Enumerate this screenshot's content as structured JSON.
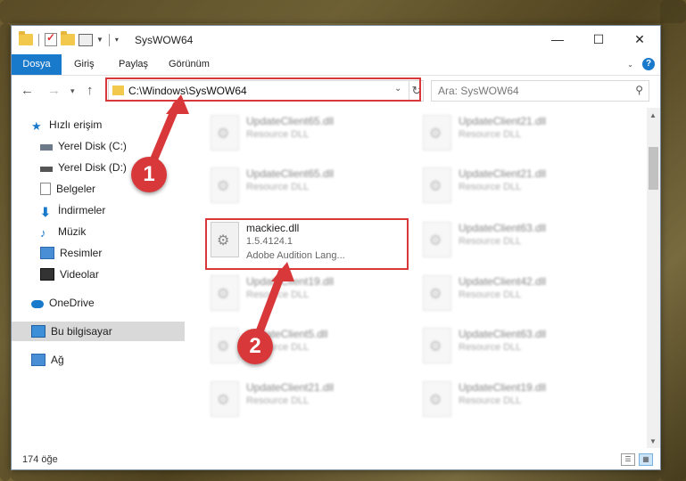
{
  "window": {
    "title": "SysWOW64"
  },
  "ribbon": {
    "tabs": [
      "Dosya",
      "Giriş",
      "Paylaş",
      "Görünüm"
    ]
  },
  "navbar": {
    "address": "C:\\Windows\\SysWOW64",
    "search_placeholder": "Ara: SysWOW64"
  },
  "sidebar": {
    "items": [
      {
        "label": "Hızlı erişim",
        "icon": "star-icon"
      },
      {
        "label": "Yerel Disk (C:)",
        "icon": "drive-icon"
      },
      {
        "label": "Yerel Disk (D:)",
        "icon": "drive-icon"
      },
      {
        "label": "Belgeler",
        "icon": "document-icon"
      },
      {
        "label": "İndirmeler",
        "icon": "download-icon"
      },
      {
        "label": "Müzik",
        "icon": "music-icon"
      },
      {
        "label": "Resimler",
        "icon": "pictures-icon"
      },
      {
        "label": "Videolar",
        "icon": "video-icon"
      },
      {
        "label": "OneDrive",
        "icon": "cloud-icon"
      },
      {
        "label": "Bu bilgisayar",
        "icon": "computer-icon"
      },
      {
        "label": "Ağ",
        "icon": "network-icon"
      }
    ]
  },
  "files": [
    {
      "name": "UpdateClient65.dll",
      "sub": "Resource DLL"
    },
    {
      "name": "UpdateClient21.dll",
      "sub": "Resource DLL"
    },
    {
      "name": "UpdateClient65.dll",
      "sub": "Resource DLL"
    },
    {
      "name": "UpdateClient21.dll",
      "sub": "Resource DLL"
    },
    {
      "name": "mackiec.dll",
      "version": "1.5.4124.1",
      "desc": "Adobe Audition Lang..."
    },
    {
      "name": "UpdateClient63.dll",
      "sub": "Resource DLL"
    },
    {
      "name": "UpdateClient19.dll",
      "sub": "Resource DLL"
    },
    {
      "name": "UpdateClient42.dll",
      "sub": "Resource DLL"
    },
    {
      "name": "UpdateClient5.dll",
      "sub": "Resource DLL"
    },
    {
      "name": "UpdateClient63.dll",
      "sub": "Resource DLL"
    },
    {
      "name": "UpdateClient21.dll",
      "sub": "Resource DLL"
    },
    {
      "name": "UpdateClient19.dll",
      "sub": "Resource DLL"
    }
  ],
  "status": {
    "count": "174 öğe"
  },
  "annotations": {
    "step1": "1",
    "step2": "2"
  },
  "colors": {
    "accent": "#1979ca",
    "highlight": "#d9383a"
  }
}
